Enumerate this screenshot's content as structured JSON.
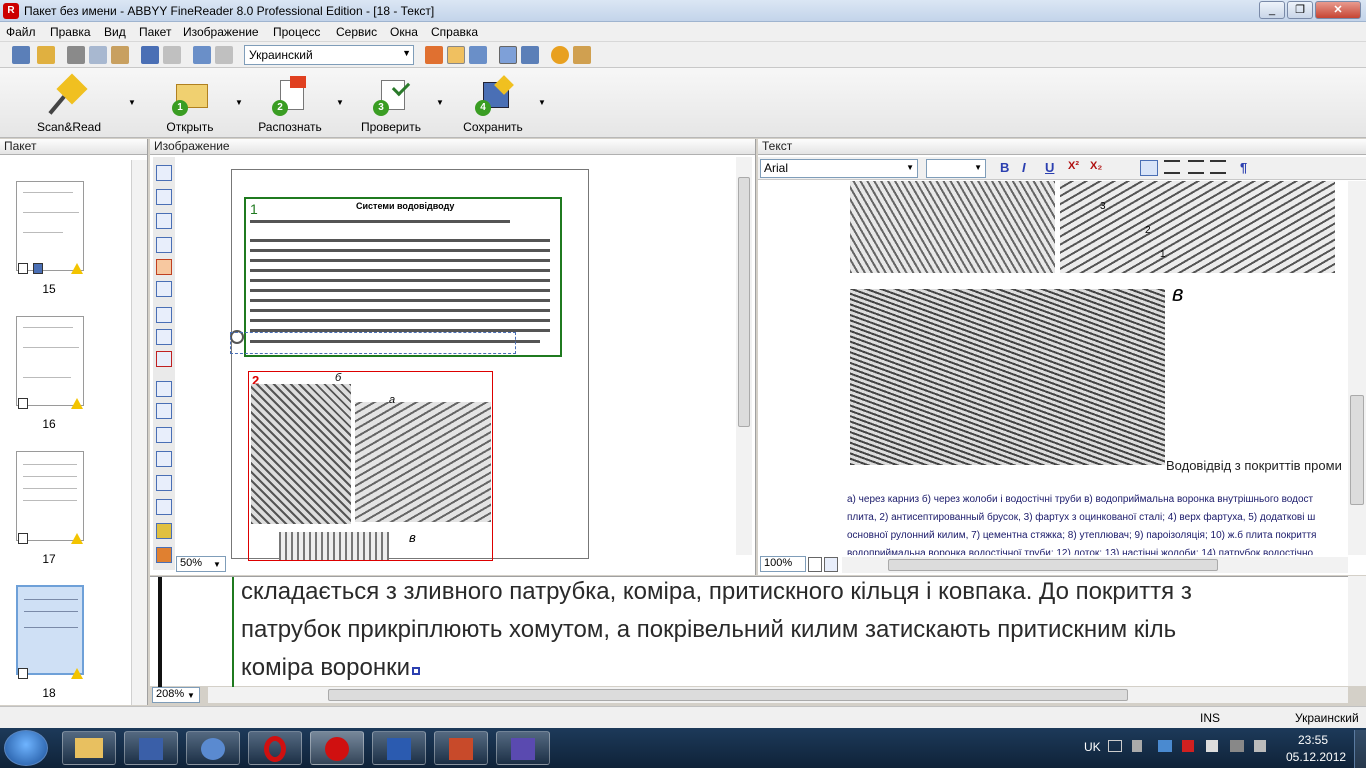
{
  "window": {
    "title": "Пакет без имени - ABBYY FineReader 8.0 Professional Edition - [18 - Текст]",
    "minimize": "_",
    "restore": "❐",
    "close": "✕"
  },
  "menu": [
    "Файл",
    "Правка",
    "Вид",
    "Пакет",
    "Изображение",
    "Процесс",
    "Сервис",
    "Окна",
    "Справка"
  ],
  "toolbar": {
    "language": "Украинский"
  },
  "bigbuttons": [
    {
      "label": "Scan&Read",
      "num": ""
    },
    {
      "label": "Открыть",
      "num": "1"
    },
    {
      "label": "Распознать",
      "num": "2"
    },
    {
      "label": "Проверить",
      "num": "3"
    },
    {
      "label": "Сохранить",
      "num": "4"
    }
  ],
  "panels": {
    "package": "Пакет",
    "image": "Изображение",
    "text": "Текст"
  },
  "thumbs": [
    "15",
    "16",
    "17",
    "18"
  ],
  "image": {
    "zoom": "50%",
    "block1_num": "1",
    "block1_title": "Системи водовідводу",
    "block2_num": "2",
    "label_a": "а",
    "label_b": "б",
    "label_v": "в"
  },
  "text": {
    "font": "Arial",
    "zoom": "100%",
    "label_v": "в",
    "fig_nums": [
      "1",
      "2",
      "3"
    ],
    "caption": "Водовідвід з покриттів проми",
    "lines": [
      "а) через карниз б) через жолоби і водостічні труби в) водоприймальна воронка внутрішнього водост",
      "плита, 2) антисептированный брусок, 3) фартух з оцинкованої сталі; 4) верх фартуха, 5) додаткові ш",
      "основної рулонний килим, 7) цементна стяжка; 8) утеплювач; 9) пароізоляція; 10) ж.б плита покриття",
      "водоприймальна воронка водостічної труби; 12) лоток; 13) настінні жолоби; 14) патрубок водостічно"
    ]
  },
  "zoomview": {
    "level": "208%",
    "lines": [
      "складається з зливного патрубка, коміра, притискного кільця і ковпака. До покриття з",
      "патрубок прикріплюють хомутом, а покрівельний килим затискають притискним кіль",
      "коміра воронки"
    ]
  },
  "status": {
    "ins": "INS",
    "lang": "Украинский"
  },
  "tray": {
    "lang": "UK",
    "time": "23:55",
    "date": "05.12.2012"
  }
}
